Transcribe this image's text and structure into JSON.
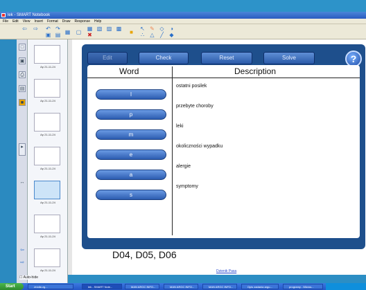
{
  "window": {
    "title": "lek - SMART Notebook"
  },
  "menu": [
    "File",
    "Edit",
    "View",
    "Insert",
    "Format",
    "Draw",
    "Response",
    "Help"
  ],
  "board": {
    "buttons": {
      "edit": "Edit",
      "check": "Check",
      "reset": "Reset",
      "solve": "Solve"
    },
    "help": "?",
    "headers": {
      "word": "Word",
      "description": "Description"
    },
    "letters": [
      "l",
      "p",
      "m",
      "e",
      "a",
      "s"
    ],
    "descriptions": [
      "ostatni posilek",
      "przebyte choroby",
      "leki",
      "okoliczności wypadku",
      "alergie",
      "symptomy"
    ]
  },
  "codes": "D04, D05, D06",
  "footer_link": "Dzienik Pasa",
  "thumb_label": "Ap 21-11-24",
  "auto_hide": "Auto-hide",
  "taskbar": {
    "start": "Start",
    "tasks": [
      "źródła zg...",
      "lek - SMART Note...",
      "MAN ARGC INFO...",
      "MAN ARGC INFO...",
      "MAN ARGC INFO...",
      "Opis zadania argu...",
      "programy - Micros..."
    ]
  }
}
